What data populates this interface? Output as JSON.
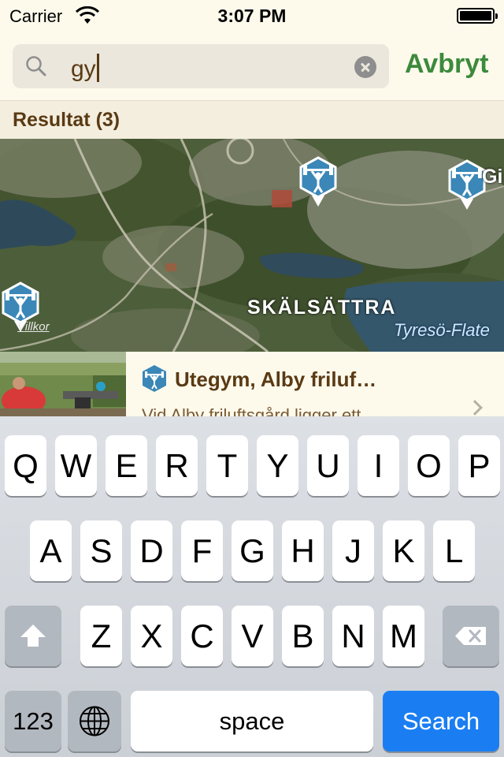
{
  "status_bar": {
    "carrier": "Carrier",
    "time": "3:07 PM",
    "icons": [
      "wifi-icon",
      "battery-icon"
    ]
  },
  "search": {
    "value": "gy",
    "cancel_label": "Avbryt",
    "icons": [
      "search-icon",
      "clear-icon"
    ]
  },
  "results": {
    "header": "Resultat (3)"
  },
  "map": {
    "place_label": "SKÄLSÄTTRA",
    "water_label": "Tyresö-Flate",
    "edge_label": "Gi",
    "terms_link": "Villkor",
    "pins": [
      "gym-pin-icon",
      "gym-pin-icon",
      "gym-pin-icon"
    ]
  },
  "result_item": {
    "title": "Utegym, Alby friluf…",
    "description": "Vid Alby friluftsgård ligger ett",
    "icon": "gym-icon"
  },
  "keyboard": {
    "row1": [
      "Q",
      "W",
      "E",
      "R",
      "T",
      "Y",
      "U",
      "I",
      "O",
      "P"
    ],
    "row2": [
      "A",
      "S",
      "D",
      "F",
      "G",
      "H",
      "J",
      "K",
      "L"
    ],
    "row3": [
      "Z",
      "X",
      "C",
      "V",
      "B",
      "N",
      "M"
    ],
    "numbers_label": "123",
    "space_label": "space",
    "search_label": "Search"
  },
  "colors": {
    "accent_green": "#3c8a3c",
    "text_brown": "#5a3a14",
    "pin_blue": "#3a87b8",
    "search_key_blue": "#1a7ef2"
  }
}
